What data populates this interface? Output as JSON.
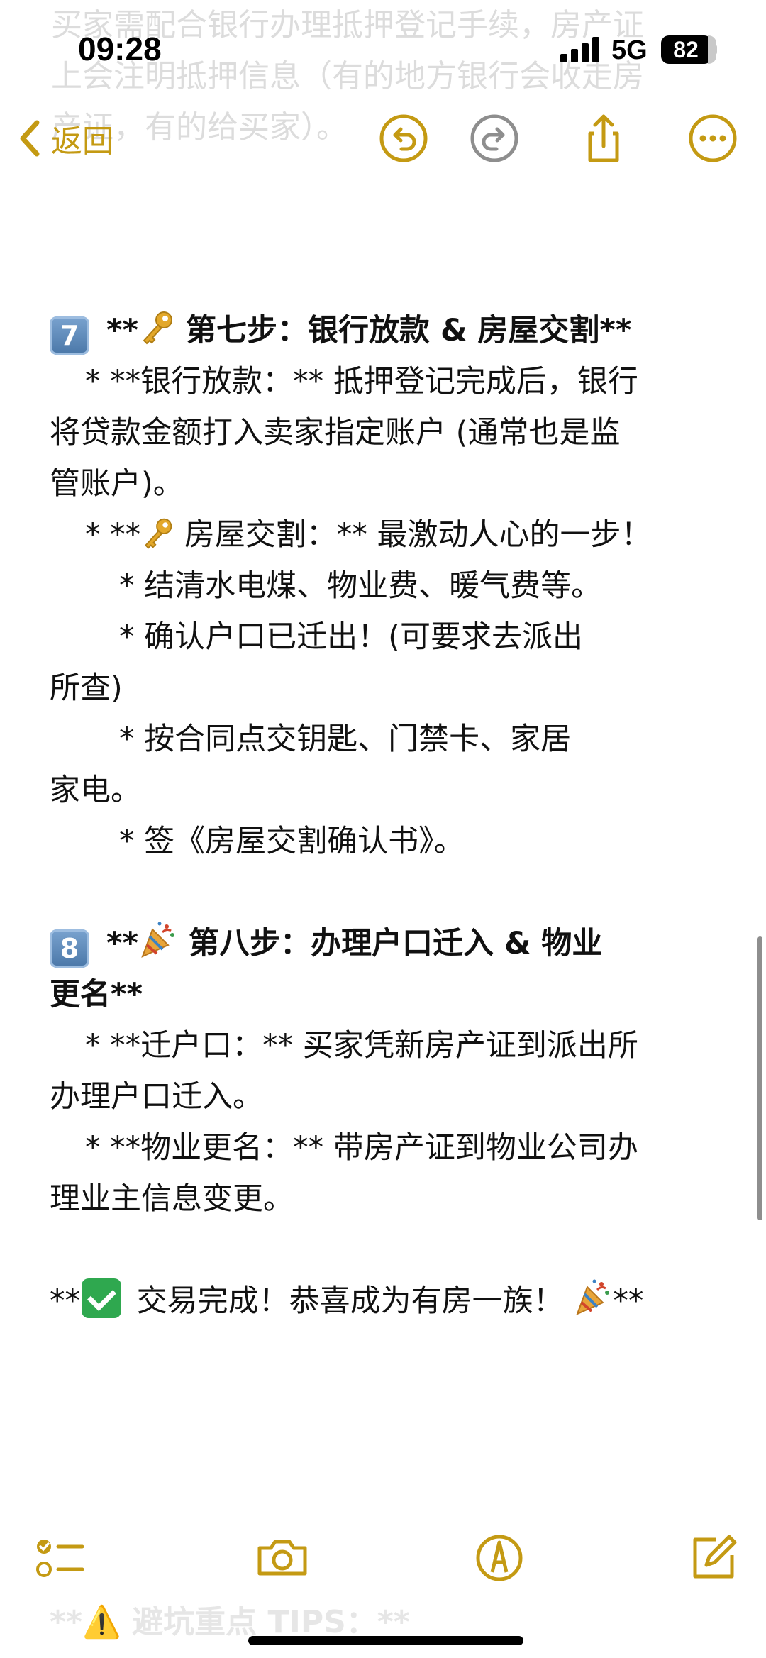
{
  "status_bar": {
    "time": "09:28",
    "network": "5G",
    "battery": "82"
  },
  "nav": {
    "back_label": "返回"
  },
  "ghost_lines": [
    "买家需配合银行办理抵押登记手续，房产证",
    "上会注明抵押信息（有的地方银行会收走房",
    "产证，有的给买家）。"
  ],
  "step7": {
    "number": "7",
    "title": "第七步：银行放款 & 房屋交割**",
    "title_prefix": "**",
    "loan_bullet": "*   **银行放款：** 抵押登记完成后，银行",
    "loan_cont1": "将贷款金额打入卖家指定账户 (通常也是监",
    "loan_cont2": "管账户)。",
    "handover_prefix": "*   **",
    "handover_text": "房屋交割：** 最激动人心的一步！",
    "sub1": "*   结清水电煤、物业费、暖气费等。",
    "sub2": "*   确认户口已迁出！(可要求去派出",
    "sub2_cont": "所查)",
    "sub3": "*   按合同点交钥匙、门禁卡、家居",
    "sub3_cont": "家电。",
    "sub4": "*   签《房屋交割确认书》。"
  },
  "step8": {
    "number": "8",
    "title_prefix": "**",
    "title": "第八步：办理户口迁入 & 物业",
    "title_cont": "更名**",
    "hukou_bullet": "*   **迁户口：** 买家凭新房产证到派出所",
    "hukou_cont": "办理户口迁入。",
    "property_bullet": "*   **物业更名：** 带房产证到物业公司办",
    "property_cont": "理业主信息变更。"
  },
  "closing": {
    "prefix": "**",
    "text": "交易完成！恭喜成为有房一族！",
    "suffix": "**"
  },
  "faded_bottom": "**⚠️ 避坑重点 TIPS：**",
  "colors": {
    "accent": "#c49a13",
    "text": "#111111",
    "check_green": "#2fa84f",
    "keycap_blue": "#4a77a8"
  },
  "icons": [
    "chevron-left-icon",
    "undo-icon",
    "redo-icon",
    "share-icon",
    "more-icon",
    "checklist-icon",
    "camera-icon",
    "markup-pen-icon",
    "compose-icon",
    "key-icon",
    "party-popper-icon",
    "check-mark-icon"
  ]
}
